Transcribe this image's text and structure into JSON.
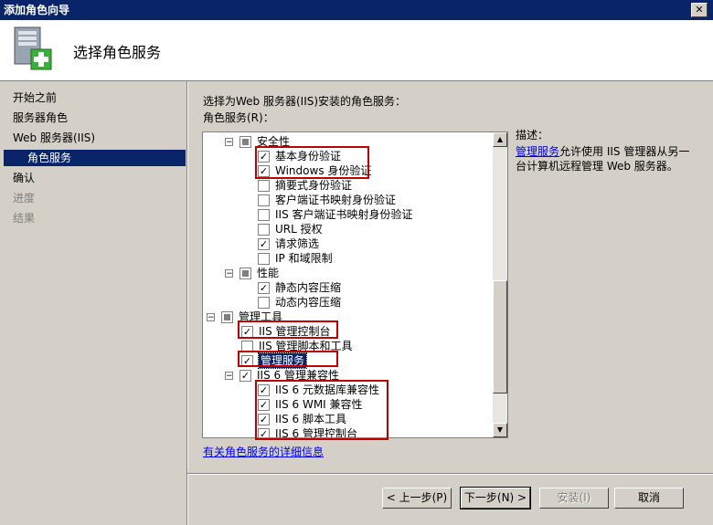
{
  "window": {
    "title": "添加角色向导"
  },
  "header": {
    "title": "选择角色服务",
    "icon": "server-add-icon"
  },
  "sidebar": {
    "items": [
      {
        "label": "开始之前",
        "state": "normal"
      },
      {
        "label": "服务器角色",
        "state": "normal"
      },
      {
        "label": "Web 服务器(IIS)",
        "state": "normal"
      },
      {
        "label": "角色服务",
        "state": "selected"
      },
      {
        "label": "确认",
        "state": "normal"
      },
      {
        "label": "进度",
        "state": "disabled"
      },
      {
        "label": "结果",
        "state": "disabled"
      }
    ]
  },
  "main": {
    "instruction": "选择为Web 服务器(IIS)安装的角色服务：",
    "list_label": "角色服务(R)：",
    "tree": [
      {
        "label": "安全性",
        "expander": "−",
        "check": "partial",
        "level": 2
      },
      {
        "label": "基本身份验证",
        "check": "checked",
        "level": 3
      },
      {
        "label": "Windows 身份验证",
        "check": "checked",
        "level": 3
      },
      {
        "label": "摘要式身份验证",
        "check": "unchecked",
        "level": 3
      },
      {
        "label": "客户端证书映射身份验证",
        "check": "unchecked",
        "level": 3
      },
      {
        "label": "IIS 客户端证书映射身份验证",
        "check": "unchecked",
        "level": 3
      },
      {
        "label": "URL 授权",
        "check": "unchecked",
        "level": 3
      },
      {
        "label": "请求筛选",
        "check": "checked",
        "level": 3
      },
      {
        "label": "IP 和域限制",
        "check": "unchecked",
        "level": 3
      },
      {
        "label": "性能",
        "expander": "−",
        "check": "partial",
        "level": 2
      },
      {
        "label": "静态内容压缩",
        "check": "checked",
        "level": 3
      },
      {
        "label": "动态内容压缩",
        "check": "unchecked",
        "level": 3
      },
      {
        "label": "管理工具",
        "expander": "−",
        "check": "partial",
        "level": 1
      },
      {
        "label": "IIS 管理控制台",
        "check": "checked",
        "level": 2
      },
      {
        "label": "IIS 管理脚本和工具",
        "check": "unchecked",
        "level": 2
      },
      {
        "label": "管理服务",
        "check": "checked",
        "level": 2,
        "selected": true
      },
      {
        "label": "IIS 6 管理兼容性",
        "expander": "−",
        "check": "checked",
        "level": 2
      },
      {
        "label": "IIS 6 元数据库兼容性",
        "check": "checked",
        "level": 3
      },
      {
        "label": "IIS 6 WMI 兼容性",
        "check": "checked",
        "level": 3
      },
      {
        "label": "IIS 6 脚本工具",
        "check": "checked",
        "level": 3
      },
      {
        "label": "IIS 6 管理控制台",
        "check": "checked",
        "level": 3
      }
    ],
    "more_info_link": "有关角色服务的详细信息"
  },
  "description": {
    "label": "描述：",
    "link": "管理服务",
    "text": "允许使用 IIS 管理器从另一台计算机远程管理 Web 服务器。"
  },
  "buttons": {
    "back": "< 上一步(P)",
    "next": "下一步(N) >",
    "install": "安装(I)",
    "cancel": "取消"
  },
  "colors": {
    "selection": "#0a246a",
    "highlight_box": "#c00000",
    "link": "#0000ee"
  }
}
